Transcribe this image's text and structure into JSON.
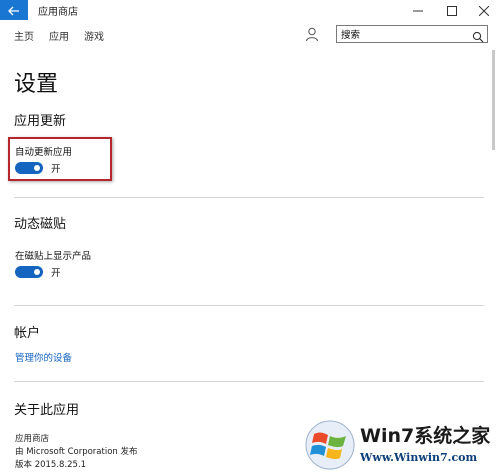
{
  "window": {
    "app_title": "应用商店",
    "accent_color": "#1976d2"
  },
  "nav": {
    "home": "主页",
    "apps": "应用",
    "games": "游戏",
    "search_value": "搜索"
  },
  "page": {
    "title": "设置"
  },
  "app_updates": {
    "heading": "应用更新",
    "auto_update_label": "自动更新应用",
    "auto_update_state": "开",
    "auto_update_on": true
  },
  "live_tile": {
    "heading": "动态磁贴",
    "show_products_label": "在磁贴上显示产品",
    "show_products_state": "开",
    "show_products_on": true
  },
  "account": {
    "heading": "帐户",
    "manage_devices_link": "管理你的设备"
  },
  "about": {
    "heading": "关于此应用",
    "app_name": "应用商店",
    "publisher": "由 Microsoft Corporation 发布",
    "version": "版本 2015.8.25.1"
  },
  "watermark": {
    "brand_top": "Win7系统之家",
    "brand_url": "Www.Winwin7.com"
  }
}
